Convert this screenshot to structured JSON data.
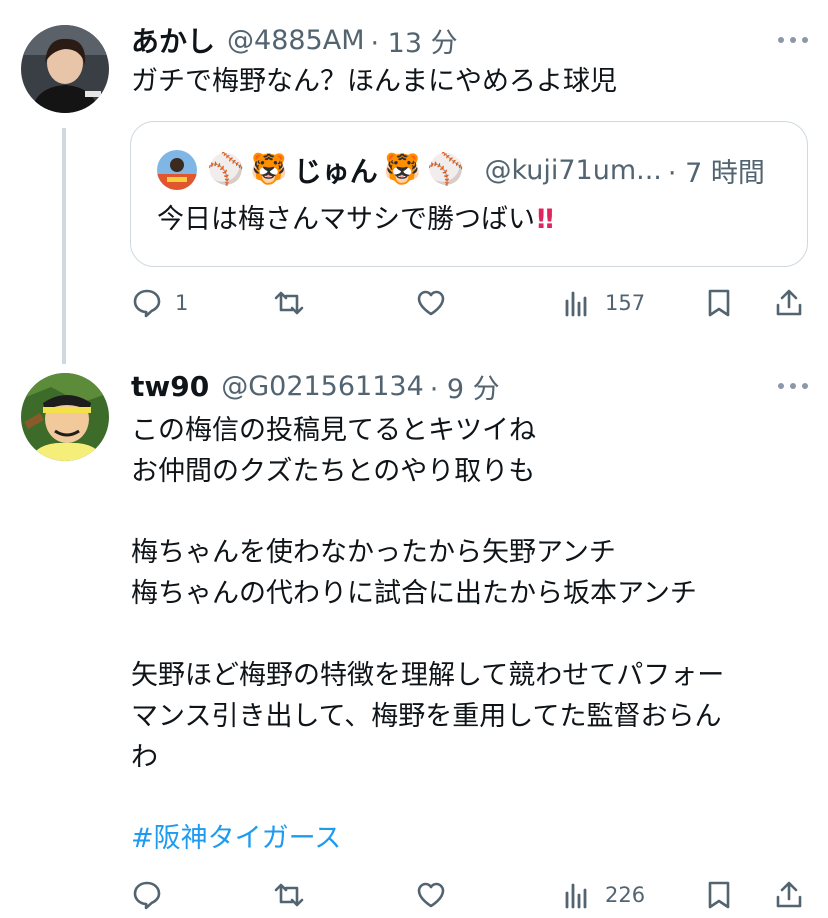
{
  "tweets": [
    {
      "name": "あかし",
      "handle": "@4885AM",
      "time": "· 13 分",
      "text": "ガチで梅野なん？ほんまにやめろよ球児",
      "quote": {
        "badge1": "⚾",
        "badge2": "🐯",
        "name": "じゅん",
        "badge3": "🐯",
        "badge4": "⚾",
        "handle": "@kuji71um...",
        "time": "· 7 時間",
        "text": "今日は梅さんマサシで勝つばい",
        "exclaim": "!!"
      },
      "actions": {
        "reply_count": "1",
        "retweet_count": "",
        "like_count": "",
        "views_count": "157"
      }
    },
    {
      "name": "tw90",
      "handle": "@G021561134",
      "time": "· 9 分",
      "lines": [
        "この梅信の投稿見てるとキツイね",
        "お仲間のクズたちとのやり取りも",
        "",
        "梅ちゃんを使わなかったから矢野アンチ",
        "梅ちゃんの代わりに試合に出たから坂本アンチ",
        "",
        "矢野ほど梅野の特徴を理解して競わせてパフォー",
        "マンス引き出して、梅野を重用してた監督おらん",
        "わ"
      ],
      "hashtag": "#阪神タイガース",
      "actions": {
        "reply_count": "",
        "retweet_count": "",
        "like_count": "",
        "views_count": "226"
      }
    }
  ],
  "icons": [
    "reply-icon",
    "retweet-icon",
    "like-icon",
    "views-icon",
    "bookmark-icon",
    "share-icon",
    "more-icon"
  ],
  "colors": {
    "text": "#0f1419",
    "secondary": "#536471",
    "link": "#1d9bf0",
    "border": "#cfd9de"
  }
}
